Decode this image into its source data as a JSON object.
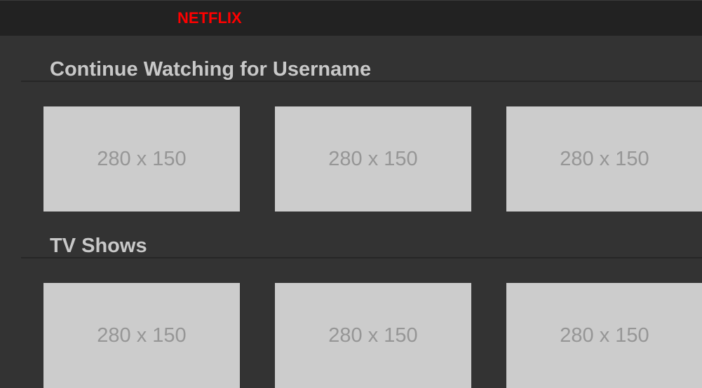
{
  "header": {
    "logo_text": "NETFLIX",
    "logo_color": "#ff0000"
  },
  "sections": [
    {
      "title": "Continue Watching for Username",
      "tiles": [
        {
          "label": "280 x 150"
        },
        {
          "label": "280 x 150"
        },
        {
          "label": "280 x 150"
        }
      ]
    },
    {
      "title": "TV Shows",
      "tiles": [
        {
          "label": "280 x 150"
        },
        {
          "label": "280 x 150"
        },
        {
          "label": "280 x 150"
        }
      ]
    }
  ]
}
